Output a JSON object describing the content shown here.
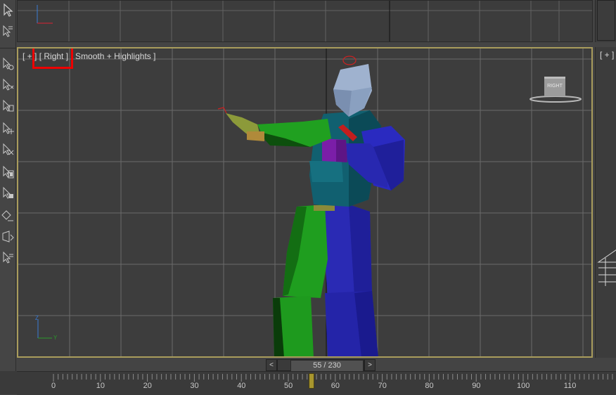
{
  "viewport": {
    "label_open": "[ + ]",
    "label_view": "[ Right ]",
    "label_shading": "[ Smooth + Highlights ]"
  },
  "viewcube": {
    "face_label": "RIGHT"
  },
  "right_viewport": {
    "label": "[ + ]"
  },
  "axis_tripod": {
    "z_label": "Z",
    "y_label": "Y"
  },
  "time_slider": {
    "prev": "<",
    "next": ">",
    "current_frame": "55 / 230"
  },
  "track_bar": {
    "ticks": [
      "0",
      "10",
      "20",
      "30",
      "40",
      "50",
      "60",
      "70",
      "80",
      "90",
      "100",
      "110"
    ],
    "current_frame": 55
  },
  "colors": {
    "active_border": "#a99c5c",
    "highlight_box": "#ee0000",
    "left_side_mesh": "#1e9a1e",
    "right_side_mesh": "#2626b8",
    "torso_mesh": "#0f5b66",
    "head_mesh": "#9fb2cf"
  }
}
